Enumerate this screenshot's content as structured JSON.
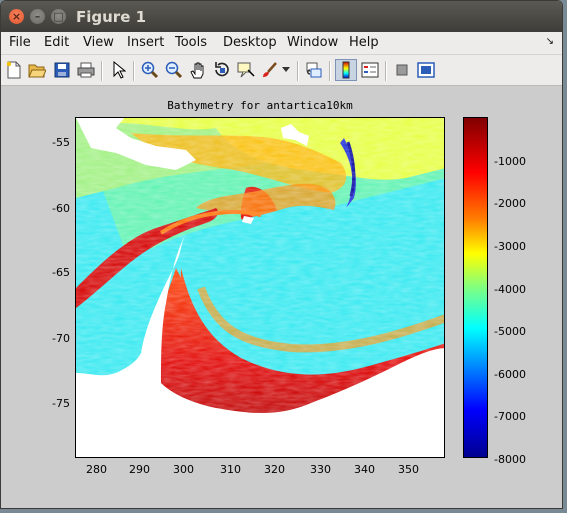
{
  "window": {
    "title": "Figure 1",
    "close_glyph": "×",
    "min_glyph": "–",
    "max_glyph": "□"
  },
  "menu": {
    "items": [
      "File",
      "Edit",
      "View",
      "Insert",
      "Tools",
      "Desktop",
      "Window",
      "Help"
    ],
    "dock_glyph": "↘"
  },
  "toolbar": {
    "buttons": [
      {
        "name": "new-figure-icon",
        "pressed": false
      },
      {
        "name": "open-file-icon",
        "pressed": false
      },
      {
        "name": "save-icon",
        "pressed": false
      },
      {
        "name": "print-icon",
        "pressed": false
      },
      {
        "name": "edit-plot-arrow-icon",
        "pressed": false
      },
      {
        "name": "zoom-in-icon",
        "pressed": false
      },
      {
        "name": "zoom-out-icon",
        "pressed": false
      },
      {
        "name": "pan-hand-icon",
        "pressed": false
      },
      {
        "name": "rotate-3d-icon",
        "pressed": false
      },
      {
        "name": "data-cursor-icon",
        "pressed": false
      },
      {
        "name": "brush-icon",
        "pressed": false
      },
      {
        "name": "link-plot-icon",
        "pressed": false
      },
      {
        "name": "colorbar-icon",
        "pressed": true
      },
      {
        "name": "legend-icon",
        "pressed": false
      },
      {
        "name": "hide-plot-tools-icon",
        "pressed": false
      },
      {
        "name": "show-plot-tools-icon",
        "pressed": false
      }
    ]
  },
  "plot": {
    "title": "Bathymetry for antartica10km",
    "x_ticks": [
      "280",
      "290",
      "300",
      "310",
      "320",
      "330",
      "340",
      "350"
    ],
    "y_ticks": [
      "-55",
      "-60",
      "-65",
      "-70",
      "-75"
    ],
    "colorbar_ticks": [
      "-1000",
      "-2000",
      "-3000",
      "-4000",
      "-5000",
      "-6000",
      "-7000",
      "-8000"
    ],
    "colorbar_colors": {
      "top": "#800000",
      "high": "#ff0000",
      "mid_high": "#ff8000",
      "middle": "#ffff00",
      "mid_low": "#00ffff",
      "low": "#0000ff",
      "bottom": "#00008f"
    }
  }
}
